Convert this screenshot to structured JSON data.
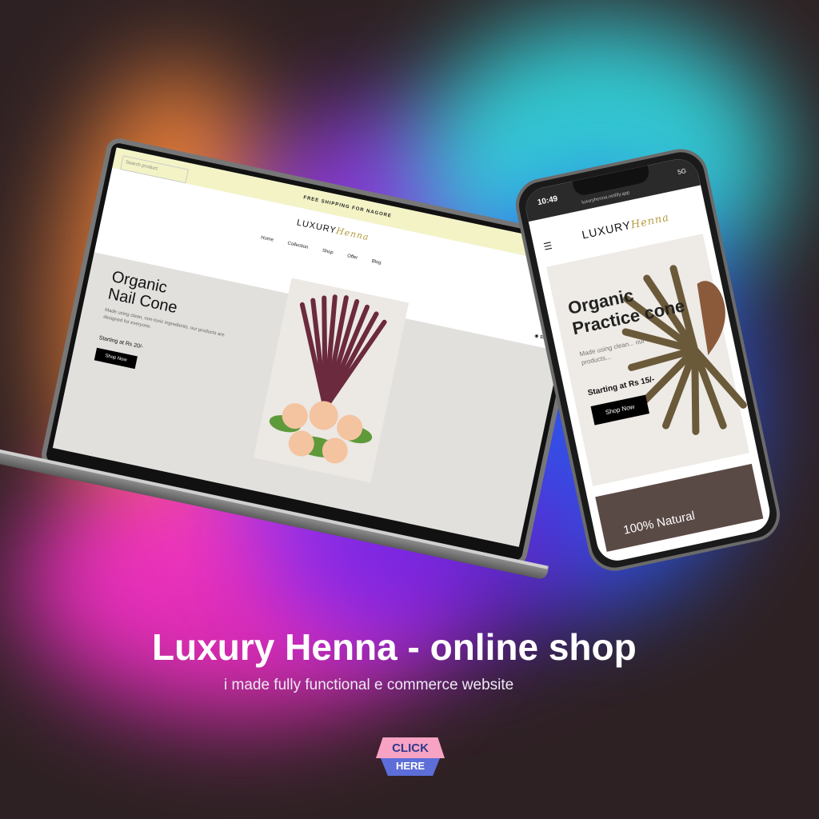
{
  "colors": {
    "background": "#2e2123",
    "cta_top": "#f8a3c3",
    "cta_bottom": "#5d6ed8",
    "logo_gold": "#b39a3c"
  },
  "laptop": {
    "topbar": "FREE SHIPPING FOR NAGORE",
    "search_placeholder": "Search product",
    "logo_main": "LUXURY",
    "logo_script": "Henna",
    "nav": [
      "Home",
      "Collection",
      "Shop",
      "Offer",
      "Blog"
    ],
    "cart": "$0.00",
    "hero_title_line1": "Organic",
    "hero_title_line2": "Nail Cone",
    "hero_desc": "Made using clean, non-toxic ingredients, our products are designed for everyone.",
    "hero_price": "Starting at Rs 20/-",
    "shop_button": "Shop Now"
  },
  "phone": {
    "time": "10:49",
    "url": "luxuryhenna.netlify.app",
    "signal": "5G",
    "logo_main": "LUXURY",
    "logo_script": "Henna",
    "hero_title_line1": "Organic",
    "hero_title_line2": "Practice cone",
    "hero_desc": "Made using clean... our products...",
    "hero_price": "Starting at Rs 15/-",
    "shop_button": "Shop Now",
    "section_text": "100% Natural"
  },
  "headline": "Luxury Henna - online shop",
  "subline": "i made fully functional e commerce website",
  "cta": {
    "top": "CLICK",
    "bottom": "HERE"
  }
}
